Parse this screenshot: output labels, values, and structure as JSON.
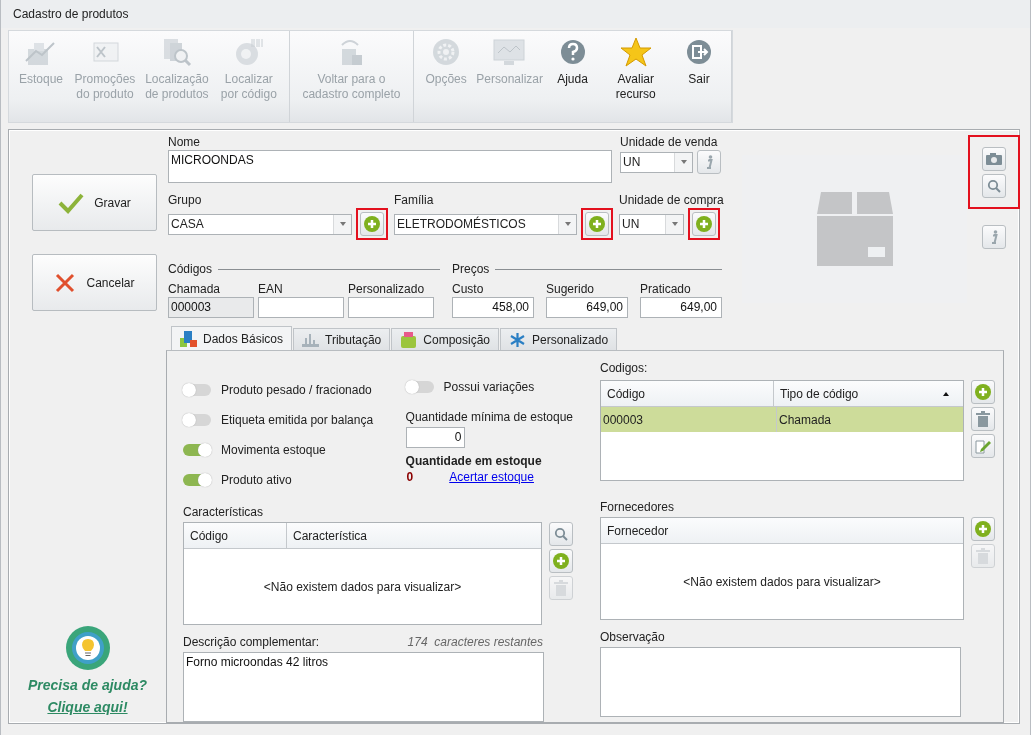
{
  "window": {
    "title": "Cadastro de produtos"
  },
  "ribbon": {
    "groups": [
      {
        "buttons": [
          {
            "label": "Estoque",
            "disabled": true
          },
          {
            "label": "Promoções do produto",
            "disabled": true
          },
          {
            "label": "Localização de produtos",
            "disabled": true
          },
          {
            "label": "Localizar por código",
            "disabled": true
          }
        ]
      },
      {
        "buttons": [
          {
            "label": "Voltar para o cadastro completo",
            "disabled": true
          }
        ]
      },
      {
        "buttons": [
          {
            "label": "Opções",
            "disabled": true
          },
          {
            "label": "Personalizar",
            "disabled": true
          },
          {
            "label": "Ajuda",
            "disabled": false
          },
          {
            "label": "Avaliar recurso",
            "disabled": false
          },
          {
            "label": "Sair",
            "disabled": false
          }
        ]
      }
    ]
  },
  "actions": [
    {
      "label": "Gravar",
      "kind": "save"
    },
    {
      "label": "Cancelar",
      "kind": "cancel"
    }
  ],
  "help": {
    "title": "Precisa de ajuda?",
    "link": "Clique aqui!"
  },
  "form": {
    "nome": {
      "label": "Nome",
      "value": "MICROONDAS"
    },
    "unidade_venda": {
      "label": "Unidade de venda",
      "value": "UN"
    },
    "grupo": {
      "label": "Grupo",
      "value": "CASA",
      "highlighted": true
    },
    "familia": {
      "label": "Família",
      "value": "ELETRODOMÉSTICOS",
      "highlighted": true
    },
    "unidade_compra": {
      "label": "Unidade de compra",
      "value": "UN",
      "highlighted": true
    },
    "codigos": {
      "title": "Códigos",
      "fields": [
        {
          "label": "Chamada",
          "value": "000003",
          "readonly": true
        },
        {
          "label": "EAN",
          "readonly": false
        },
        {
          "label": "Personalizado",
          "readonly": false
        }
      ]
    },
    "precos": {
      "title": "Preços",
      "fields": [
        {
          "label": "Custo",
          "value": "458,00"
        },
        {
          "label": "Sugerido",
          "value": "649,00"
        },
        {
          "label": "Praticado",
          "value": "649,00"
        }
      ]
    }
  },
  "image_panel": {
    "highlighted": true
  },
  "tabs": [
    {
      "label": "Dados Básicos",
      "selected": true
    },
    {
      "label": "Tributação",
      "selected": false
    },
    {
      "label": "Composição",
      "selected": false
    },
    {
      "label": "Personalizado",
      "selected": false
    }
  ],
  "toggles": [
    {
      "label": "Produto pesado / fracionado",
      "on": false
    },
    {
      "label": "Etiqueta emitida por balança",
      "on": false
    },
    {
      "label": "Movimenta estoque",
      "on": true
    },
    {
      "label": "Produto ativo",
      "on": true
    }
  ],
  "variacoes": {
    "label": "Possui variações",
    "on": false
  },
  "estoque_minimo": {
    "label": "Quantidade mínima de estoque",
    "value": "0"
  },
  "estoque": {
    "label": "Quantidade em estoque",
    "value": "0",
    "link": "Acertar estoque"
  },
  "codigos_table": {
    "title": "Codigos:",
    "columns": [
      "Código",
      "Tipo de código"
    ],
    "rows": [
      {
        "cells": [
          "000003",
          "Chamada"
        ],
        "selected": true
      }
    ]
  },
  "caracteristicas": {
    "title": "Características",
    "columns": [
      "Código",
      "Característica"
    ],
    "empty": "<Não existem dados para visualizar>"
  },
  "fornecedores": {
    "title": "Fornecedores",
    "columns": [
      "Fornecedor"
    ],
    "empty": "<Não existem dados para visualizar>",
    "delete_disabled": true
  },
  "descricao": {
    "label": "Descrição complementar:",
    "counter": "174  caracteres restantes",
    "value": "Forno microondas 42 litros"
  },
  "observacao": {
    "label": "Observação"
  }
}
